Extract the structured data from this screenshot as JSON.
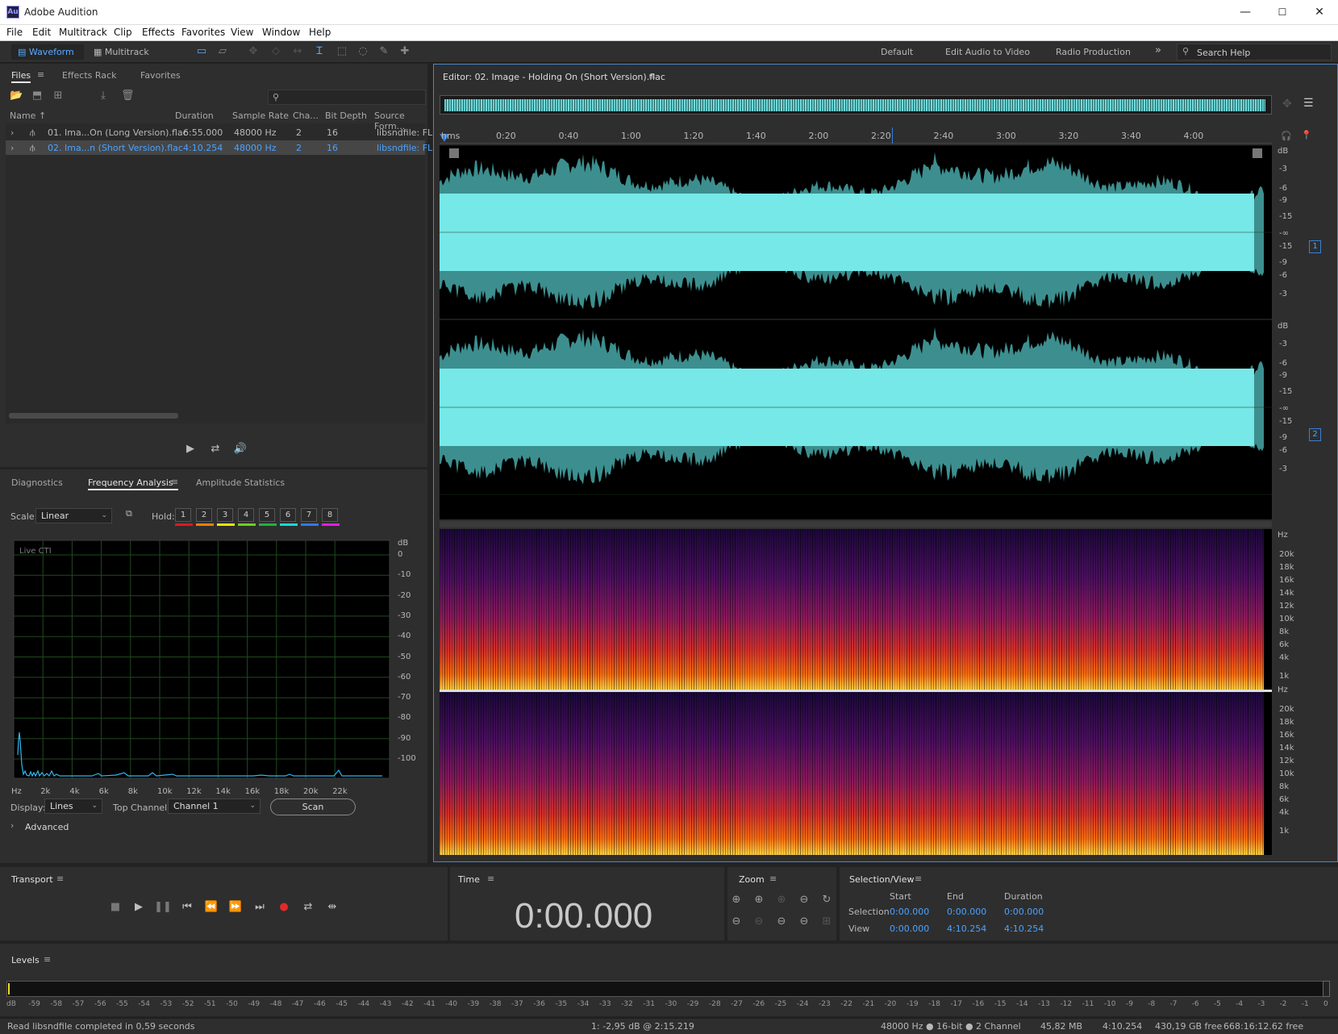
{
  "window": {
    "title": "Adobe Audition",
    "logo_text": "Au",
    "min": "—",
    "max": "☐",
    "close": "✕"
  },
  "menu": [
    "File",
    "Edit",
    "Multitrack",
    "Clip",
    "Effects",
    "Favorites",
    "View",
    "Window",
    "Help"
  ],
  "toolbar": {
    "waveform": "Waveform",
    "multitrack": "Multitrack"
  },
  "workspaces": {
    "default": "Default",
    "edit_av": "Edit Audio to Video",
    "radio": "Radio Production",
    "more": "»",
    "search": "Search Help"
  },
  "files_panel": {
    "tabs": [
      "Files",
      "Effects Rack",
      "Favorites"
    ],
    "headers": [
      "Name ↑",
      "Duration",
      "Sample Rate",
      "Cha...",
      "Bit Depth",
      "Source Form..."
    ],
    "rows": [
      {
        "name": "01. Ima...On (Long Version).flac",
        "duration": "6:55.000",
        "rate": "48000 Hz",
        "ch": "2",
        "depth": "16",
        "src": "libsndfile: FL",
        "selected": false
      },
      {
        "name": "02. Ima...n (Short Version).flac",
        "duration": "4:10.254",
        "rate": "48000 Hz",
        "ch": "2",
        "depth": "16",
        "src": "libsndfile: FL",
        "selected": true
      }
    ]
  },
  "analysis_panel": {
    "tabs": [
      "Diagnostics",
      "Frequency Analysis",
      "Amplitude Statistics"
    ],
    "scale_label": "Scale:",
    "scale_value": "Linear",
    "hold_label": "Hold:",
    "hold": [
      {
        "n": "1",
        "color": "#e0191d"
      },
      {
        "n": "2",
        "color": "#f07f0e"
      },
      {
        "n": "3",
        "color": "#f4e400"
      },
      {
        "n": "4",
        "color": "#6bd11a"
      },
      {
        "n": "5",
        "color": "#1bb53c"
      },
      {
        "n": "6",
        "color": "#19d8d8"
      },
      {
        "n": "7",
        "color": "#3278f0"
      },
      {
        "n": "8",
        "color": "#e21ee2"
      }
    ],
    "live": "Live CTI",
    "db_unit": "dB",
    "db_ticks": [
      "0",
      "-10",
      "-20",
      "-30",
      "-40",
      "-50",
      "-60",
      "-70",
      "-80",
      "-90",
      "-100"
    ],
    "hz_ticks": [
      "Hz",
      "2k",
      "4k",
      "6k",
      "8k",
      "10k",
      "12k",
      "14k",
      "16k",
      "18k",
      "20k",
      "22k"
    ],
    "display_label": "Display:",
    "display_value": "Lines",
    "top_channel_label": "Top Channel:",
    "top_channel_value": "Channel 1",
    "scan": "Scan",
    "advanced": "Advanced"
  },
  "editor": {
    "title": "Editor: 02. Image - Holding On (Short Version).flac",
    "ruler": [
      "hms",
      "0:20",
      "0:40",
      "1:00",
      "1:20",
      "1:40",
      "2:00",
      "2:20",
      "2:40",
      "3:00",
      "3:20",
      "3:40",
      "4:00"
    ],
    "db_labels": [
      "dB",
      "-3",
      "-6",
      "-9",
      "-15",
      "-∞",
      "-15",
      "-9",
      "-6",
      "-3"
    ],
    "hz_labels": [
      "Hz",
      "20k",
      "18k",
      "16k",
      "14k",
      "12k",
      "10k",
      "8k",
      "6k",
      "4k",
      "1k"
    ],
    "ch1": "1",
    "ch2": "2"
  },
  "transport": {
    "title": "Transport"
  },
  "time": {
    "title": "Time",
    "value": "0:00.000"
  },
  "zoom": {
    "title": "Zoom"
  },
  "selection": {
    "title": "Selection/View",
    "cols": [
      "Start",
      "End",
      "Duration"
    ],
    "sel_label": "Selection",
    "view_label": "View",
    "sel": [
      "0:00.000",
      "0:00.000",
      "0:00.000"
    ],
    "view": [
      "0:00.000",
      "4:10.254",
      "4:10.254"
    ]
  },
  "levels": {
    "title": "Levels",
    "scale": [
      "dB",
      "-59",
      "-58",
      "-57",
      "-56",
      "-55",
      "-54",
      "-53",
      "-52",
      "-51",
      "-50",
      "-49",
      "-48",
      "-47",
      "-46",
      "-45",
      "-44",
      "-43",
      "-42",
      "-41",
      "-40",
      "-39",
      "-38",
      "-37",
      "-36",
      "-35",
      "-34",
      "-33",
      "-32",
      "-31",
      "-30",
      "-29",
      "-28",
      "-27",
      "-26",
      "-25",
      "-24",
      "-23",
      "-22",
      "-21",
      "-20",
      "-19",
      "-18",
      "-17",
      "-16",
      "-15",
      "-14",
      "-13",
      "-12",
      "-11",
      "-10",
      "-9",
      "-8",
      "-7",
      "-6",
      "-5",
      "-4",
      "-3",
      "-2",
      "-1",
      "0"
    ]
  },
  "status": {
    "left": "Read libsndfile completed in 0,59 seconds",
    "cursor": "1: -2,95 dB @ 2:15.219",
    "format": "48000 Hz ● 16-bit ● 2 Channel",
    "size": "45,82 MB",
    "dur": "4:10.254",
    "free": "430,19 GB free",
    "free_time": "668:16:12.62 free"
  }
}
